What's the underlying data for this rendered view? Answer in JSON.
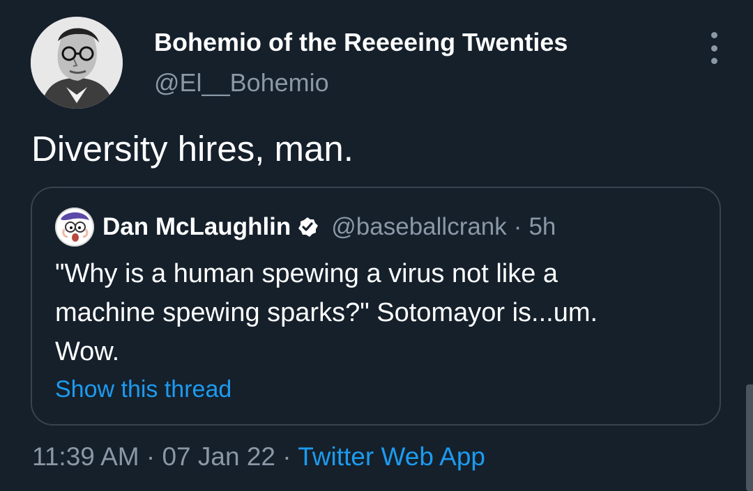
{
  "tweet": {
    "author": {
      "display_name": "Bohemio of the Reeeeing Twenties",
      "handle": "@El__Bohemio",
      "avatar_icon": "portrait-avatar-icon"
    },
    "more_icon": "more-vertical-icon",
    "text": "Diversity hires, man.",
    "quoted": {
      "author": {
        "display_name": "Dan McLaughlin",
        "verified_icon": "verified-badge-icon",
        "handle": "@baseballcrank",
        "separator": "·",
        "time": "5h",
        "avatar_icon": "cartoon-avatar-icon"
      },
      "text_lines": [
        "\"Why is a human spewing a virus not like a",
        "machine spewing sparks?\" Sotomayor is...um.",
        "Wow."
      ],
      "show_thread": "Show this thread"
    },
    "meta": {
      "time": "11:39 AM",
      "separator": "·",
      "date": "07 Jan 22",
      "source": "Twitter Web App"
    }
  },
  "colors": {
    "background": "#15202b",
    "text": "#ffffff",
    "secondary": "#8b98a5",
    "accent": "#1d9bf0",
    "border": "#38444d"
  }
}
